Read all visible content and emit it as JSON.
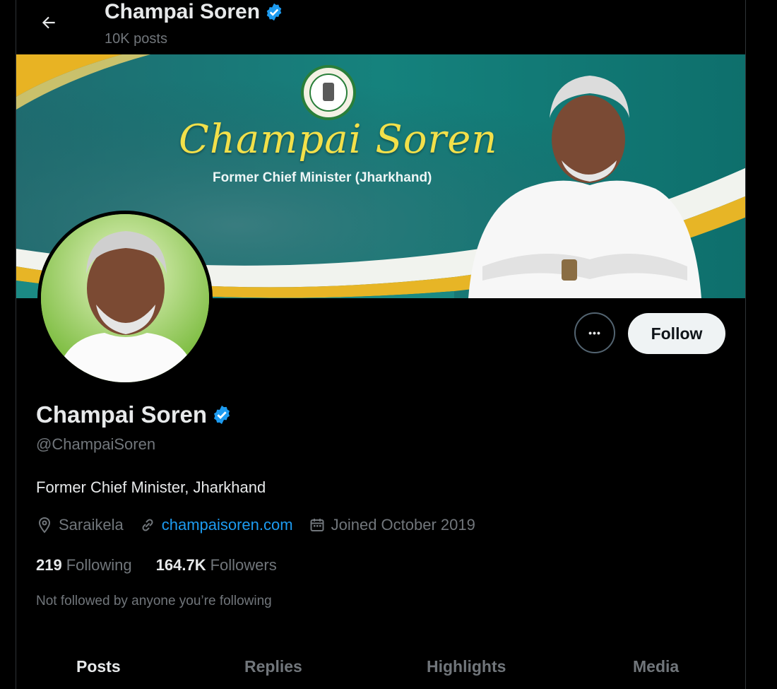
{
  "header": {
    "back_label": "Back",
    "name": "Champai Soren",
    "posts_count": "10K posts"
  },
  "banner": {
    "title": "Champai Soren",
    "subtitle": "Former Chief Minister (Jharkhand)"
  },
  "profile": {
    "name": "Champai Soren",
    "handle": "@ChampaiSoren",
    "bio": "Former Chief Minister, Jharkhand",
    "location": "Saraikela",
    "website": "champaisoren.com",
    "joined": "Joined October 2019",
    "following_count": "219",
    "following_label": "Following",
    "followers_count": "164.7K",
    "followers_label": "Followers",
    "not_followed_note": "Not followed by anyone you’re following"
  },
  "actions": {
    "more_label": "•••",
    "follow_label": "Follow"
  },
  "tabs": [
    {
      "label": "Posts",
      "active": true
    },
    {
      "label": "Replies",
      "active": false
    },
    {
      "label": "Highlights",
      "active": false
    },
    {
      "label": "Media",
      "active": false
    }
  ],
  "colors": {
    "background": "#000000",
    "verified": "#1d9bf0",
    "link": "#1d9bf0",
    "secondary_text": "#71767b",
    "banner_teal": "#0f7f7a",
    "banner_gold": "#e6b32a"
  },
  "icons": {
    "back": "arrow-left-icon",
    "verified": "verified-badge-icon",
    "location": "location-pin-icon",
    "link": "link-icon",
    "calendar": "calendar-icon"
  }
}
